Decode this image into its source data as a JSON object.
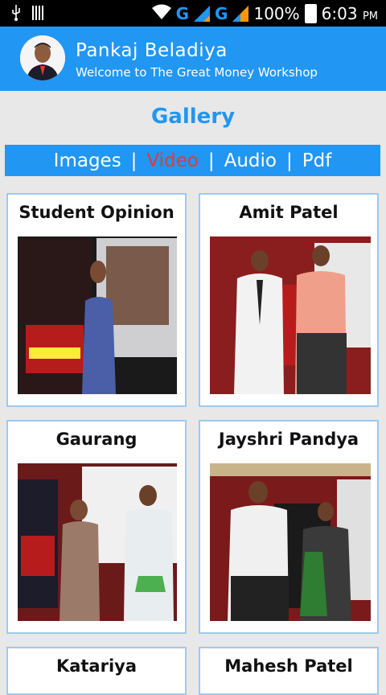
{
  "status_bar": {
    "battery": "100%",
    "time": "6:03",
    "ampm": "PM",
    "network_1": "G",
    "network_2": "G",
    "icons": [
      "usb-icon",
      "barcode-icon",
      "wifi-icon",
      "signal-icon",
      "battery-icon"
    ]
  },
  "header": {
    "name": "Pankaj Beladiya",
    "subtitle": "Welcome to The Great Money Workshop"
  },
  "page": {
    "title": "Gallery"
  },
  "tabs": {
    "items": [
      {
        "label": "Images",
        "active": false
      },
      {
        "label": "Video",
        "active": true
      },
      {
        "label": "Audio",
        "active": false
      },
      {
        "label": "Pdf",
        "active": false
      }
    ],
    "separator": "|"
  },
  "colors": {
    "primary": "#2196f3",
    "active_tab": "#e53935"
  },
  "cards": [
    {
      "title": "Student Opinion"
    },
    {
      "title": "Amit Patel"
    },
    {
      "title": "Gaurang"
    },
    {
      "title": "Jayshri Pandya"
    },
    {
      "title": "Katariya"
    },
    {
      "title": "Mahesh Patel"
    }
  ]
}
